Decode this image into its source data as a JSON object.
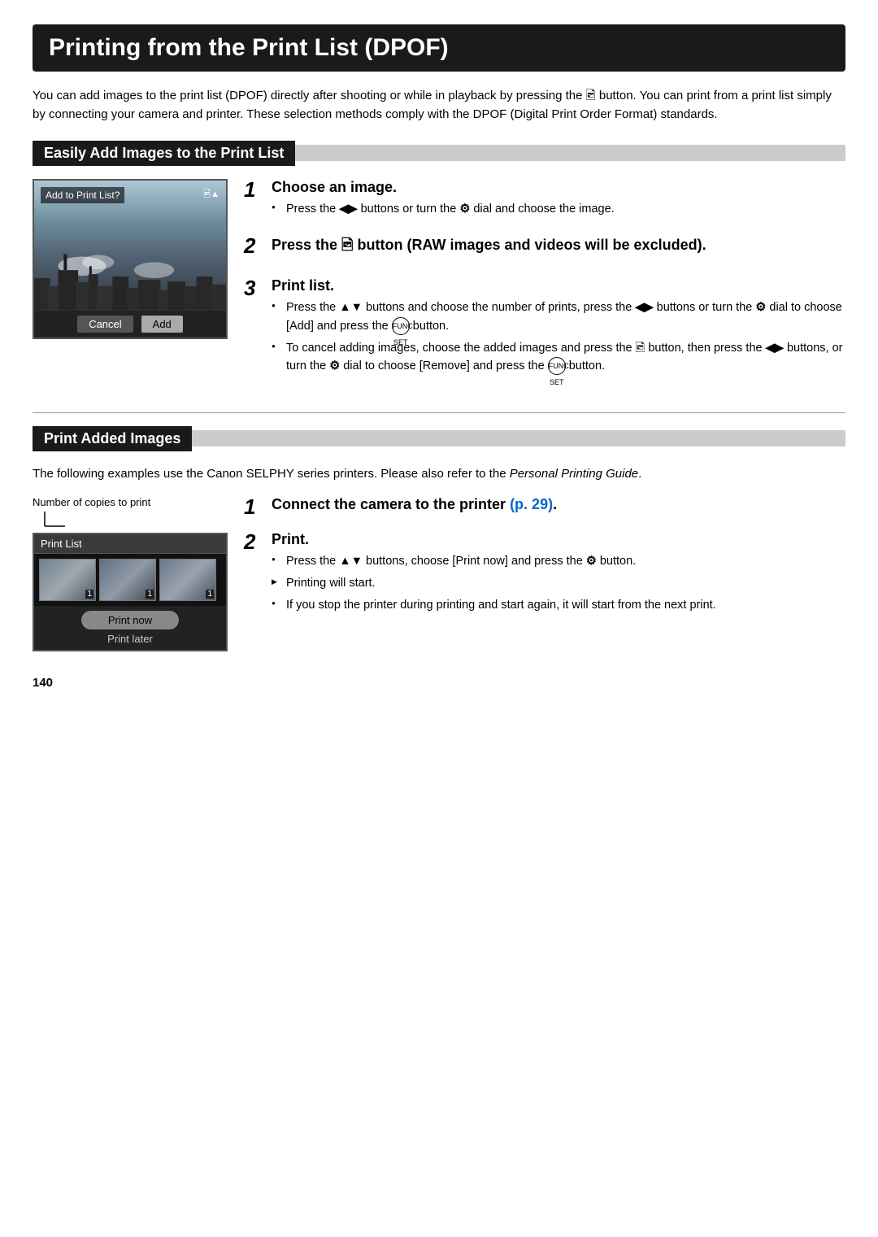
{
  "page": {
    "title": "Printing from the Print List (DPOF)",
    "page_number": "140"
  },
  "intro": {
    "text": "You can add images to the print list (DPOF) directly after shooting or while in playback by pressing the 🖻 button. You can print from a print list simply by connecting your camera and printer. These selection methods comply with the DPOF (Digital Print Order Format) standards."
  },
  "section1": {
    "header": "Easily Add Images to the Print List",
    "camera_label": "Add to Print List?",
    "cancel_btn": "Cancel",
    "add_btn": "Add",
    "step1": {
      "number": "1",
      "title": "Choose an image.",
      "bullets": [
        "Press the ◀▶ buttons or turn the ◉ dial and choose the image."
      ]
    },
    "step2": {
      "number": "2",
      "title": "Press the 🖻 button (RAW images and videos will be excluded)."
    },
    "step3": {
      "number": "3",
      "title": "Print list.",
      "bullets": [
        "Press the ▲▼ buttons and choose the number of prints, press the ◀▶ buttons or turn the ◉ dial to choose [Add] and press the FUNC/SET button.",
        "To cancel adding images, choose the added images and press the 🖻 button, then press the ◀▶ buttons, or turn the ◉ dial to choose [Remove] and press the FUNC/SET button."
      ]
    }
  },
  "section2": {
    "header": "Print Added Images",
    "intro": "The following examples use the Canon SELPHY series printers. Please also refer to the Personal Printing Guide.",
    "number_copies_label": "Number of copies to print",
    "print_list_label": "Print List",
    "print_now_btn": "Print now",
    "print_later_btn": "Print later",
    "step1": {
      "number": "1",
      "title": "Connect the camera to the printer (p. 29).",
      "link_text": "(p. 29)"
    },
    "step2": {
      "number": "2",
      "title": "Print.",
      "bullets": [
        "Press the ▲▼ buttons, choose [Print now] and press the ◉ button.",
        "Printing will start.",
        "If you stop the printer during printing and start again, it will start from the next print."
      ],
      "arrow_bullets": [
        "Printing will start."
      ]
    }
  },
  "icons": {
    "func_set": "FUNC\nSET",
    "lr_arrows": "◀▶",
    "ud_arrows": "▲▼",
    "dial": "⚙",
    "print_btn": "🖶"
  }
}
